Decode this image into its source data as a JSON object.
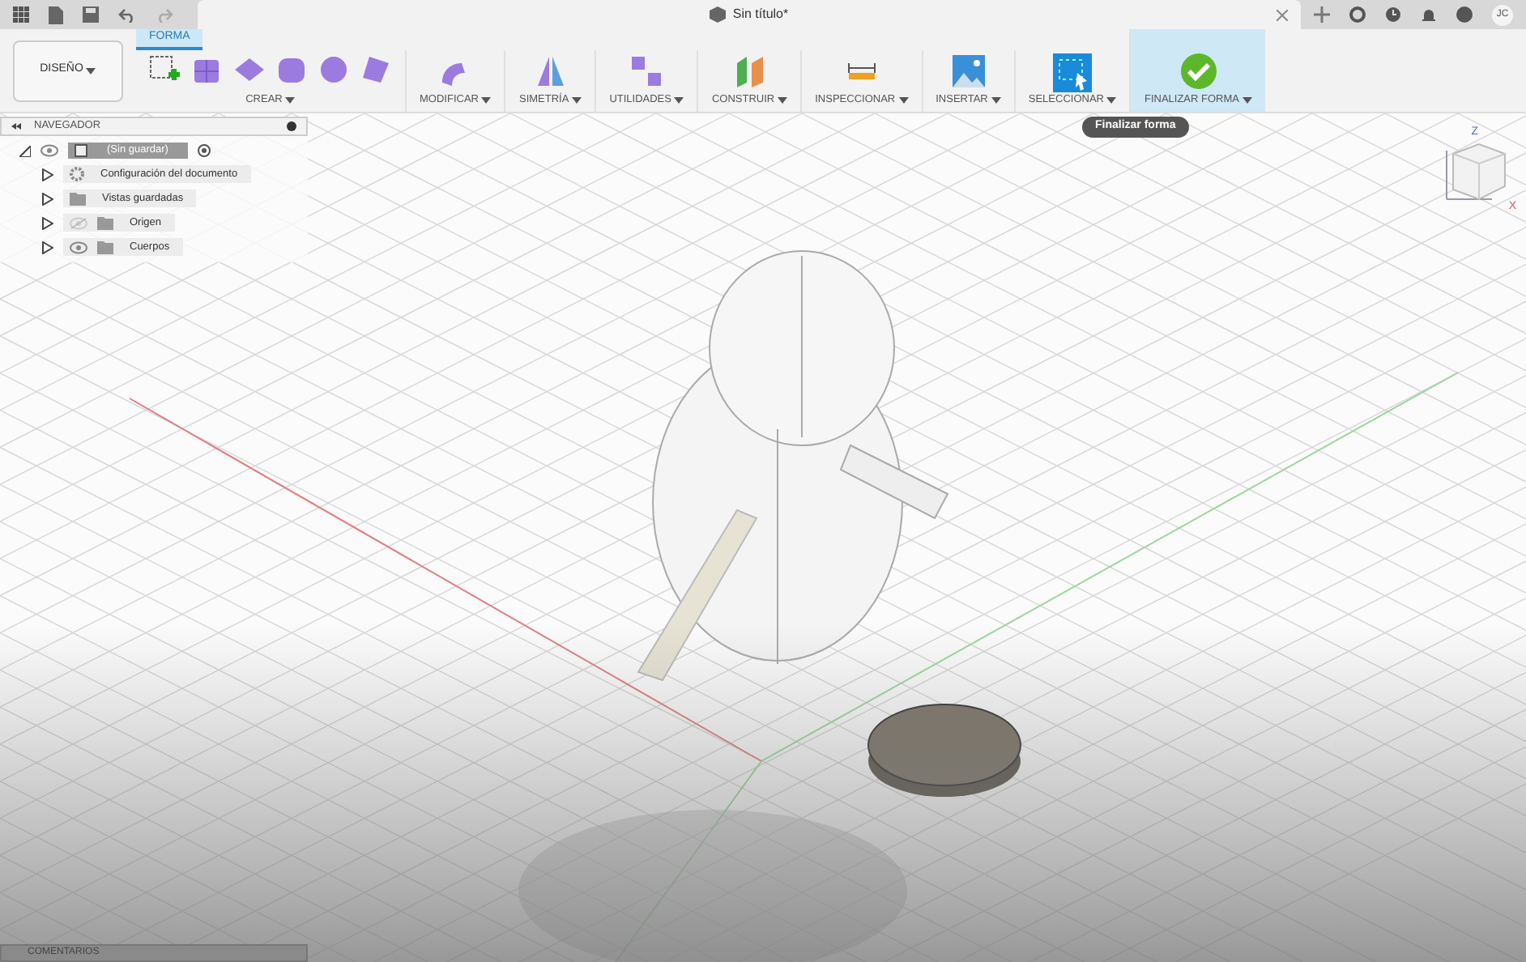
{
  "app_bar": {
    "document_title": "Sin título*",
    "user_initials": "JC"
  },
  "workspace": {
    "label": "DISEÑO"
  },
  "tabs": [
    {
      "label": "FORMA",
      "selected": true
    }
  ],
  "tool_groups": [
    {
      "label": "CREAR",
      "kind": "create",
      "selected": false
    },
    {
      "label": "MODIFICAR",
      "kind": "modify",
      "selected": false
    },
    {
      "label": "SIMETRÍA",
      "kind": "symmetry",
      "selected": false
    },
    {
      "label": "UTILIDADES",
      "kind": "utilities",
      "selected": false
    },
    {
      "label": "CONSTRUIR",
      "kind": "construct",
      "selected": false
    },
    {
      "label": "INSPECCIONAR",
      "kind": "inspect",
      "selected": false
    },
    {
      "label": "INSERTAR",
      "kind": "insert",
      "selected": false
    },
    {
      "label": "SELECCIONAR",
      "kind": "select",
      "selected": false
    },
    {
      "label": "FINALIZAR FORMA",
      "kind": "finish",
      "selected": true
    }
  ],
  "tooltip": "Finalizar forma",
  "navigator": {
    "title": "NAVEGADOR",
    "root": {
      "label": "(Sin guardar)",
      "expanded": true,
      "children": [
        {
          "label": "Configuración del documento",
          "kind": "settings",
          "expanded": false
        },
        {
          "label": "Vistas guardadas",
          "kind": "folder",
          "expanded": false
        },
        {
          "label": "Origen",
          "kind": "folder",
          "visible": false,
          "expanded": false
        },
        {
          "label": "Cuerpos",
          "kind": "folder",
          "visible": true,
          "expanded": false
        }
      ]
    }
  },
  "view_cube": {
    "axes": [
      "Z",
      "X"
    ]
  },
  "comments": {
    "title": "COMENTARIOS"
  }
}
